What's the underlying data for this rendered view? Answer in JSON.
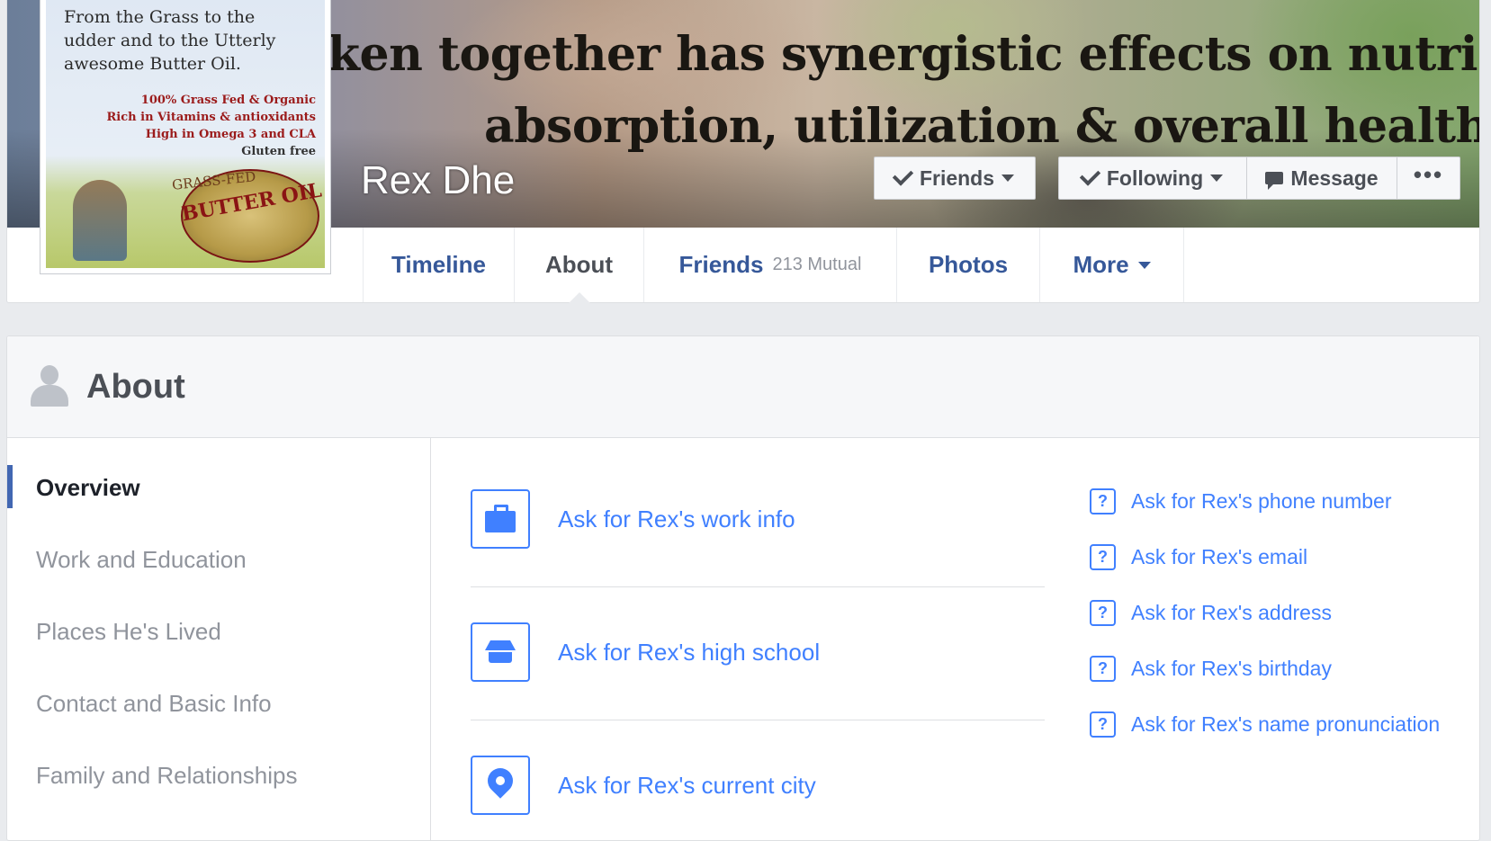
{
  "profile": {
    "name": "Rex Dhe",
    "cover_text": [
      "ken together has synergistic effects on nutrient",
      "absorption, utilization & overall health."
    ],
    "avatar_text": {
      "tagline": "From the Grass to the udder and to the Utterly awesome Butter Oil.",
      "tagline_lines": [
        "From the Grass to the",
        "udder and to the Utterly",
        "awesome Butter Oil."
      ],
      "features": [
        "100% Grass Fed & Organic",
        "Rich in Vitamins & antioxidants",
        "High in Omega 3 and CLA",
        "Gluten free"
      ],
      "logo_small": "GRASS-FED",
      "logo_big": "BUTTER OIL"
    }
  },
  "actions": {
    "friends": "Friends",
    "following": "Following",
    "message": "Message",
    "more": "•••"
  },
  "tabs": [
    {
      "label": "Timeline"
    },
    {
      "label": "About"
    },
    {
      "label": "Friends",
      "sub": "213 Mutual"
    },
    {
      "label": "Photos"
    },
    {
      "label": "More"
    }
  ],
  "about": {
    "title": "About",
    "sidebar": [
      "Overview",
      "Work and Education",
      "Places He's Lived",
      "Contact and Basic Info",
      "Family and Relationships"
    ],
    "ask_main": [
      {
        "label": "Ask for Rex's work info",
        "icon": "briefcase-icon"
      },
      {
        "label": "Ask for Rex's high school",
        "icon": "graduation-cap-icon"
      },
      {
        "label": "Ask for Rex's current city",
        "icon": "location-pin-icon"
      }
    ],
    "ask_contact": [
      "Ask for Rex's phone number",
      "Ask for Rex's email",
      "Ask for Rex's address",
      "Ask for Rex's birthday",
      "Ask for Rex's name pronunciation"
    ],
    "question_glyph": "?"
  },
  "colors": {
    "link": "#4080ff",
    "nav": "#365899",
    "background": "#e9ebee",
    "active_bar": "#4267b2"
  }
}
